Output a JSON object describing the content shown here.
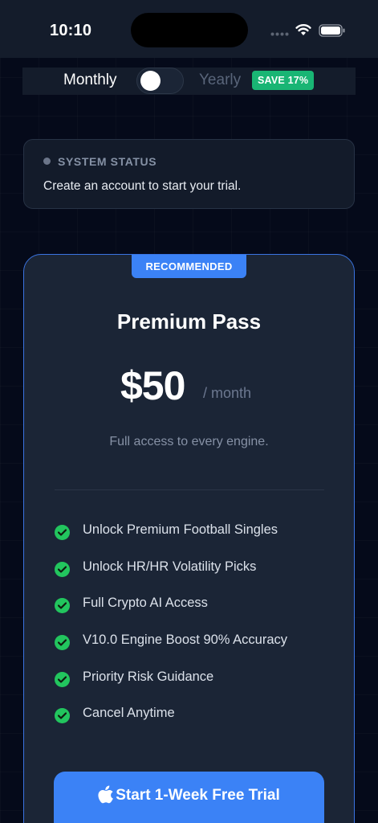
{
  "status_bar": {
    "time": "10:10",
    "icons": [
      "signal-icon",
      "wifi-icon",
      "battery-icon"
    ]
  },
  "billing_toggle": {
    "monthly_label": "Monthly",
    "yearly_label": "Yearly",
    "save_badge": "SAVE 17%",
    "selected": "Monthly"
  },
  "system_status": {
    "title": "SYSTEM STATUS",
    "message": "Create an account to start your trial."
  },
  "plan": {
    "badge": "RECOMMENDED",
    "name": "Premium Pass",
    "price": "$50",
    "period": "/ month",
    "description": "Full access to every engine.",
    "features": [
      "Unlock Premium Football Singles",
      "Unlock HR/HR Volatility Picks",
      "Full Crypto AI Access",
      "V10.0 Engine Boost 90% Accuracy",
      "Priority Risk Guidance",
      "Cancel Anytime"
    ],
    "cta_label": "Start 1-Week Free Trial",
    "cta_icon": "apple-icon"
  },
  "colors": {
    "background": "#050a1a",
    "card": "#1b2536",
    "accent": "#3b82f6",
    "success": "#22c55e",
    "badge_green": "#19b574"
  }
}
